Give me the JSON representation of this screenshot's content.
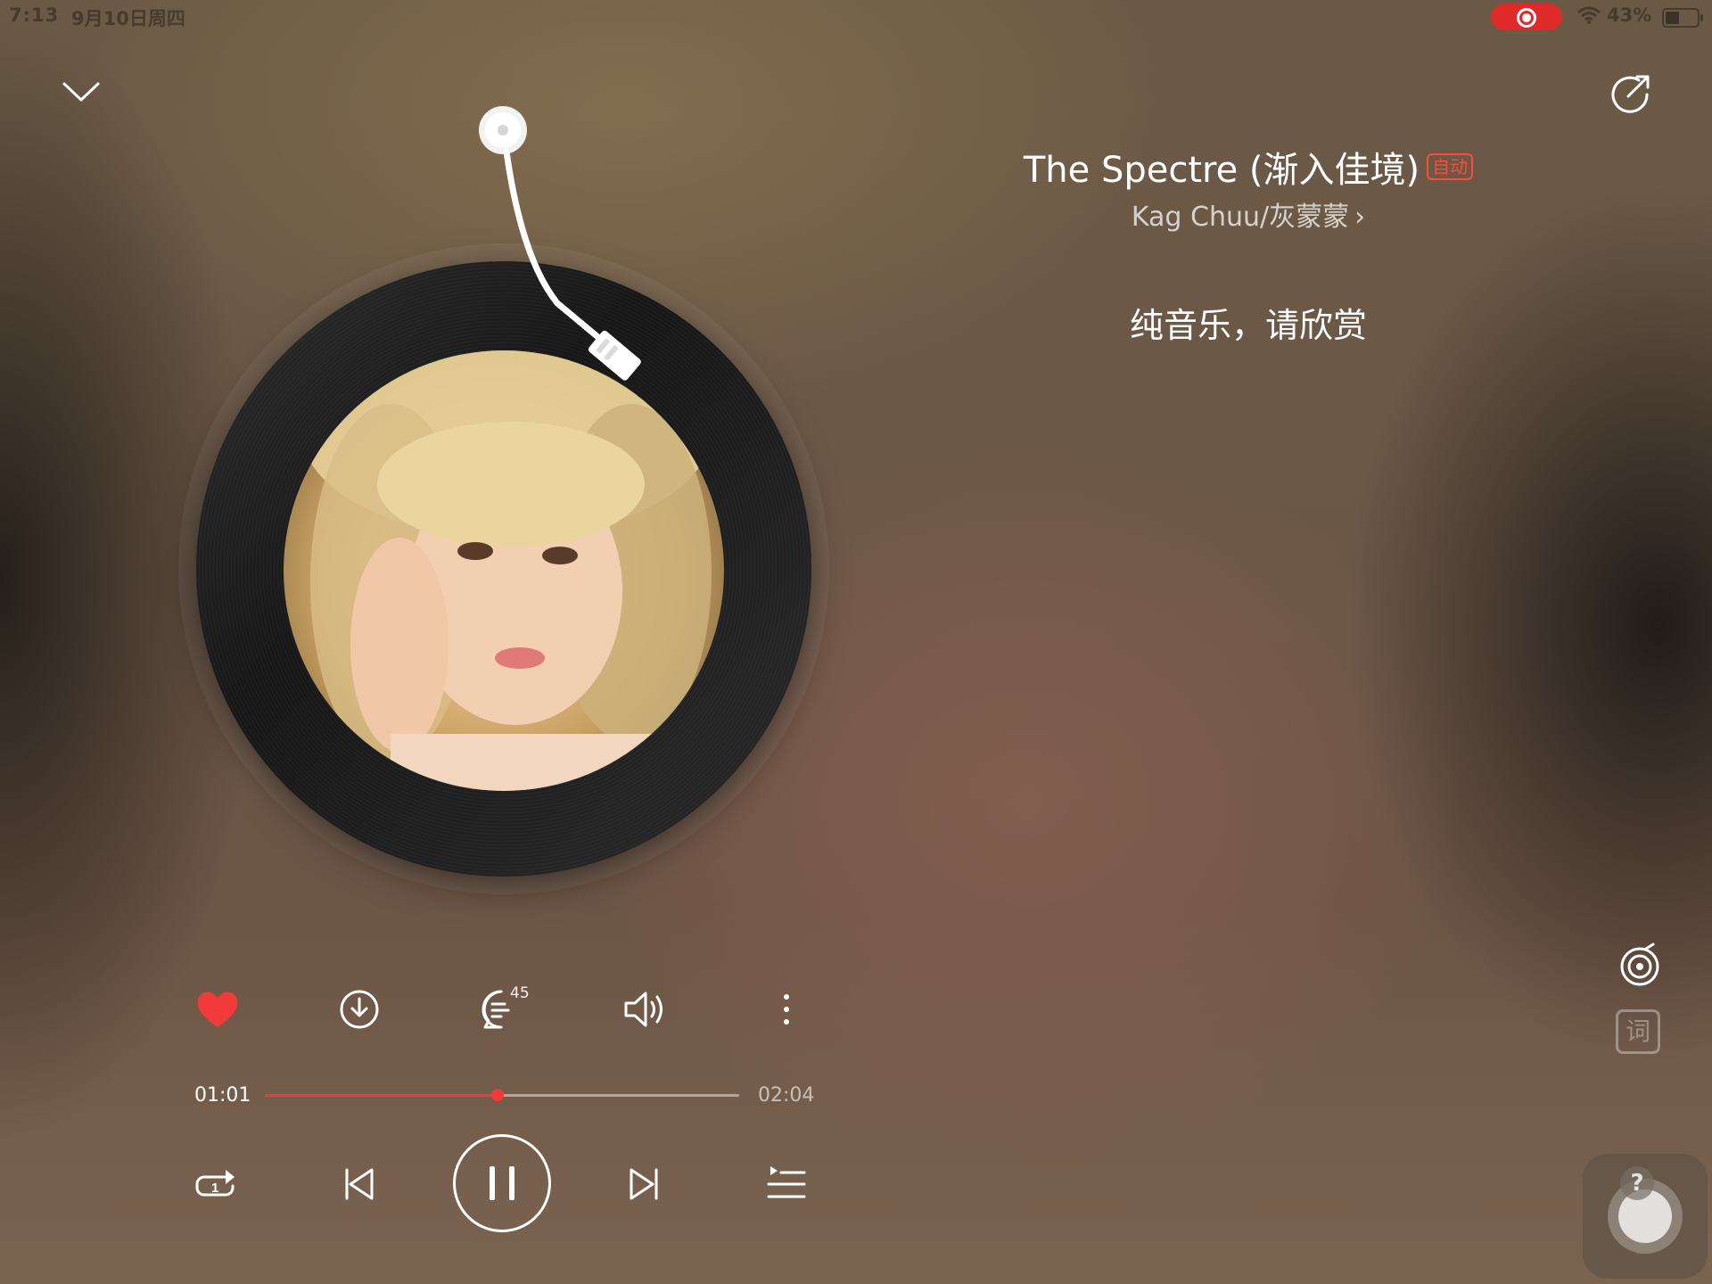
{
  "status_bar": {
    "time": "7:13",
    "date": "9月10日周四",
    "battery_percent": "43%",
    "battery_level": 0.43,
    "recording_indicator": "screen-record-icon"
  },
  "header": {
    "collapse_icon": "chevron-down-icon",
    "share_icon": "share-icon"
  },
  "song": {
    "title": "The Spectre (渐入佳境)",
    "badge": "自动",
    "artist": "Kag Chuu/灰蒙蒙",
    "artist_chevron": "›",
    "lyric": "纯音乐，请欣赏"
  },
  "actions": {
    "like_icon": "heart-icon",
    "liked": true,
    "download_icon": "download-icon",
    "comment_icon": "comment-icon",
    "comment_count": "45",
    "sound_icon": "speaker-icon",
    "more_icon": "more-vertical-icon"
  },
  "progress": {
    "current_time": "01:01",
    "total_time": "02:04",
    "fraction": 0.49
  },
  "controls": {
    "repeat_icon": "repeat-one-icon",
    "prev_icon": "previous-track-icon",
    "play_state_icon": "pause-icon",
    "next_icon": "next-track-icon",
    "playlist_icon": "playlist-icon"
  },
  "side_rail": {
    "vinyl_icon": "vinyl-mode-icon",
    "lyric_mode_label": "词"
  },
  "colors": {
    "accent": "#f23a3a",
    "badge": "#ff4a3c",
    "text": "#ffffff"
  }
}
